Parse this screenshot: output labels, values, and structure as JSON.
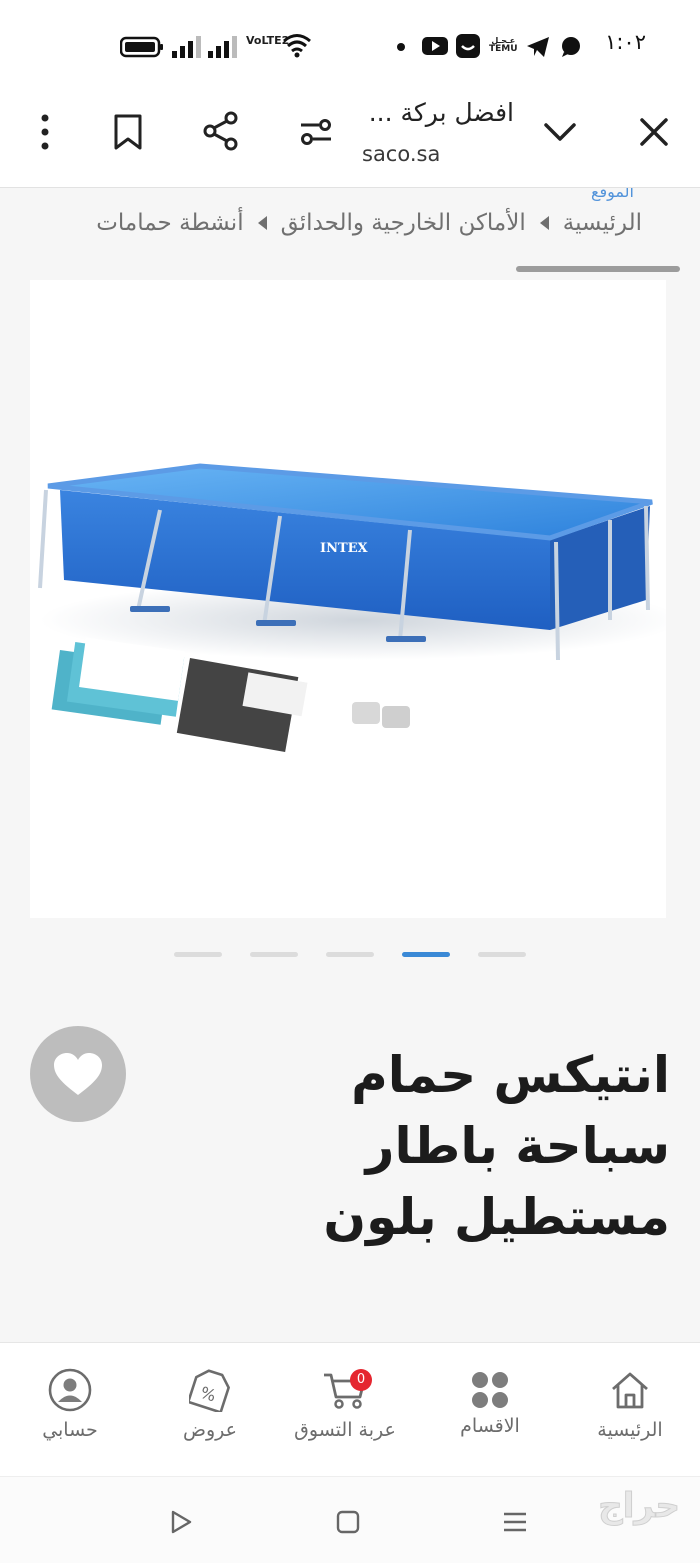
{
  "status_bar": {
    "time": "١:٠٢",
    "network_label": "VoLTE2",
    "temu_label": "TEMU",
    "ar_app_label": "عـجـل"
  },
  "browser": {
    "page_title": "افضل بركة ...",
    "domain": "saco.sa"
  },
  "breadcrumb": {
    "peek_text": "الموقع",
    "items": [
      "الرئيسية",
      "الأماكن الخارجية والحدائق",
      "أنشطة حمامات"
    ]
  },
  "gallery": {
    "image_label": "INTEX",
    "slide_count": 5,
    "active_slide_index": 3
  },
  "product": {
    "title": "انتيكس حمام سباحة باطار مستطيل بلون"
  },
  "bottom_nav": {
    "items": [
      {
        "label": "الرئيسية",
        "icon": "home-icon"
      },
      {
        "label": "الاقسام",
        "icon": "categories-icon"
      },
      {
        "label": "عربة التسوق",
        "icon": "cart-icon",
        "badge": "0"
      },
      {
        "label": "عروض",
        "icon": "offers-tag-icon"
      },
      {
        "label": "حسابي",
        "icon": "account-icon"
      }
    ]
  },
  "watermark": {
    "text": "حراج"
  },
  "colors": {
    "accent": "#3a89d6",
    "badge": "#e5262f",
    "pool_blue": "#2f6fd0",
    "heart_bg": "#bdbdbd"
  }
}
